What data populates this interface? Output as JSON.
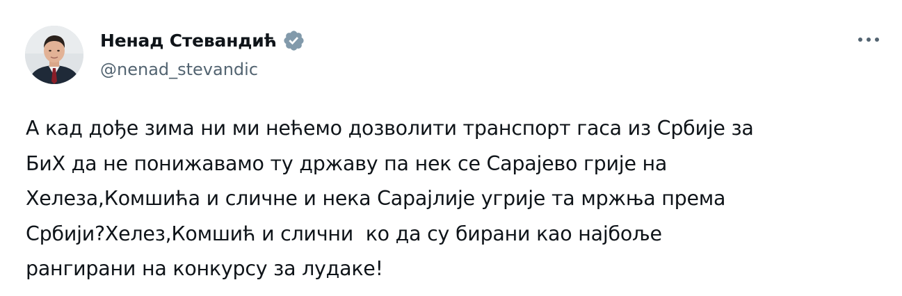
{
  "author": {
    "display_name": "Ненад Стевандић",
    "handle": "@nenad_stevandic",
    "verified": true,
    "avatar": "profile-photo"
  },
  "menu": {
    "icon": "more-horizontal-icon"
  },
  "tweet": {
    "lines": [
      "А кад дође зима ни ми нећемо дозволити транспорт гаса из Србије за",
      "БиХ да не понижавамо ту државу па нек се Сарајево грије на",
      "Хелеза,Комшића и сличне и нека Сарајлије угрије та мржња према",
      "Србији?Хелез,Комшић и слични  ко да су бирани као најбоље",
      "рангирани на конкурсу за лудаке!"
    ]
  },
  "colors": {
    "text": "#0f1419",
    "secondary_text": "#536471",
    "verified_badge": "#829aab",
    "background": "#ffffff"
  }
}
